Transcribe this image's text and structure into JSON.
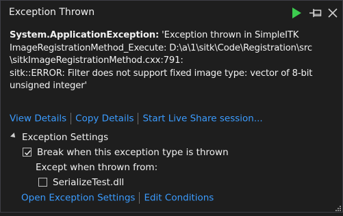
{
  "window": {
    "title": "Exception Thrown"
  },
  "icons": {
    "play": "play-icon",
    "pin": "pin-icon",
    "close": "close-icon",
    "collapse": "collapse-arrow-icon",
    "checkmark": "checkmark-icon",
    "resize": "resize-grip-icon"
  },
  "message": {
    "exception_type": "System.ApplicationException:",
    "line1_rest": " 'Exception thrown in SimpleITK",
    "line2": "ImageRegistrationMethod_Execute: D:\\a\\1\\sitk\\Code\\Registration\\src",
    "line3": "\\sitkImageRegistrationMethod.cxx:791:",
    "line4": "sitk::ERROR: Filter does not support fixed image type: vector of 8-bit",
    "line5": "unsigned integer'"
  },
  "links": {
    "view_details": "View Details",
    "copy_details": "Copy Details",
    "live_share": "Start Live Share session..."
  },
  "exception_settings": {
    "header": "Exception Settings",
    "break_when_thrown": {
      "label": "Break when this exception type is thrown",
      "checked": true
    },
    "except_when_label": "Except when thrown from:",
    "serialize_test": {
      "label": "SerializeTest.dll",
      "checked": false
    }
  },
  "bottom_links": {
    "open_settings": "Open Exception Settings",
    "edit_conditions": "Edit Conditions"
  },
  "colors": {
    "background": "#1e1e1e",
    "link": "#3b9cff",
    "play_green": "#3ccc4f",
    "text": "#f1f1f1"
  }
}
